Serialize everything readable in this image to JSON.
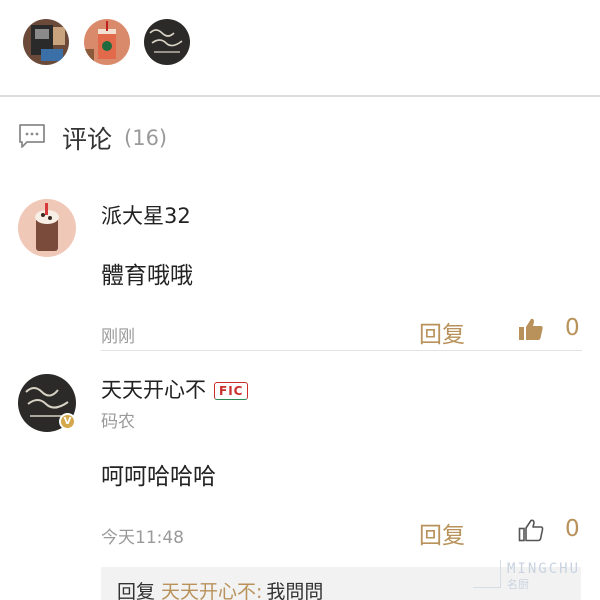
{
  "recent_avatars": [
    {
      "name": "avatar-coffee-machine"
    },
    {
      "name": "avatar-iced-drink"
    },
    {
      "name": "avatar-chalkboard"
    }
  ],
  "comments_header": {
    "icon": "comment-bubble-icon",
    "title": "评论",
    "count": "(16)"
  },
  "comments": [
    {
      "username": "派大星32",
      "content": "體育哦哦",
      "time": "刚刚",
      "reply_label": "回复",
      "likes": "0",
      "liked": true
    },
    {
      "username": "天天开心不",
      "badge": "FIC",
      "subtitle": "码农",
      "content": "呵呵哈哈哈",
      "time": "今天11:48",
      "reply_label": "回复",
      "likes": "0",
      "liked": false,
      "verified": "V"
    }
  ],
  "reply_preview": {
    "prefix": "回复",
    "target_user": "天天开心不:",
    "text": "我問問"
  },
  "watermark": {
    "brand": "MINGCHU",
    "brand_cn": "名厨"
  },
  "colors": {
    "accent": "#b8925a",
    "muted": "#9a9a9a",
    "divider": "#dcdcdc"
  }
}
